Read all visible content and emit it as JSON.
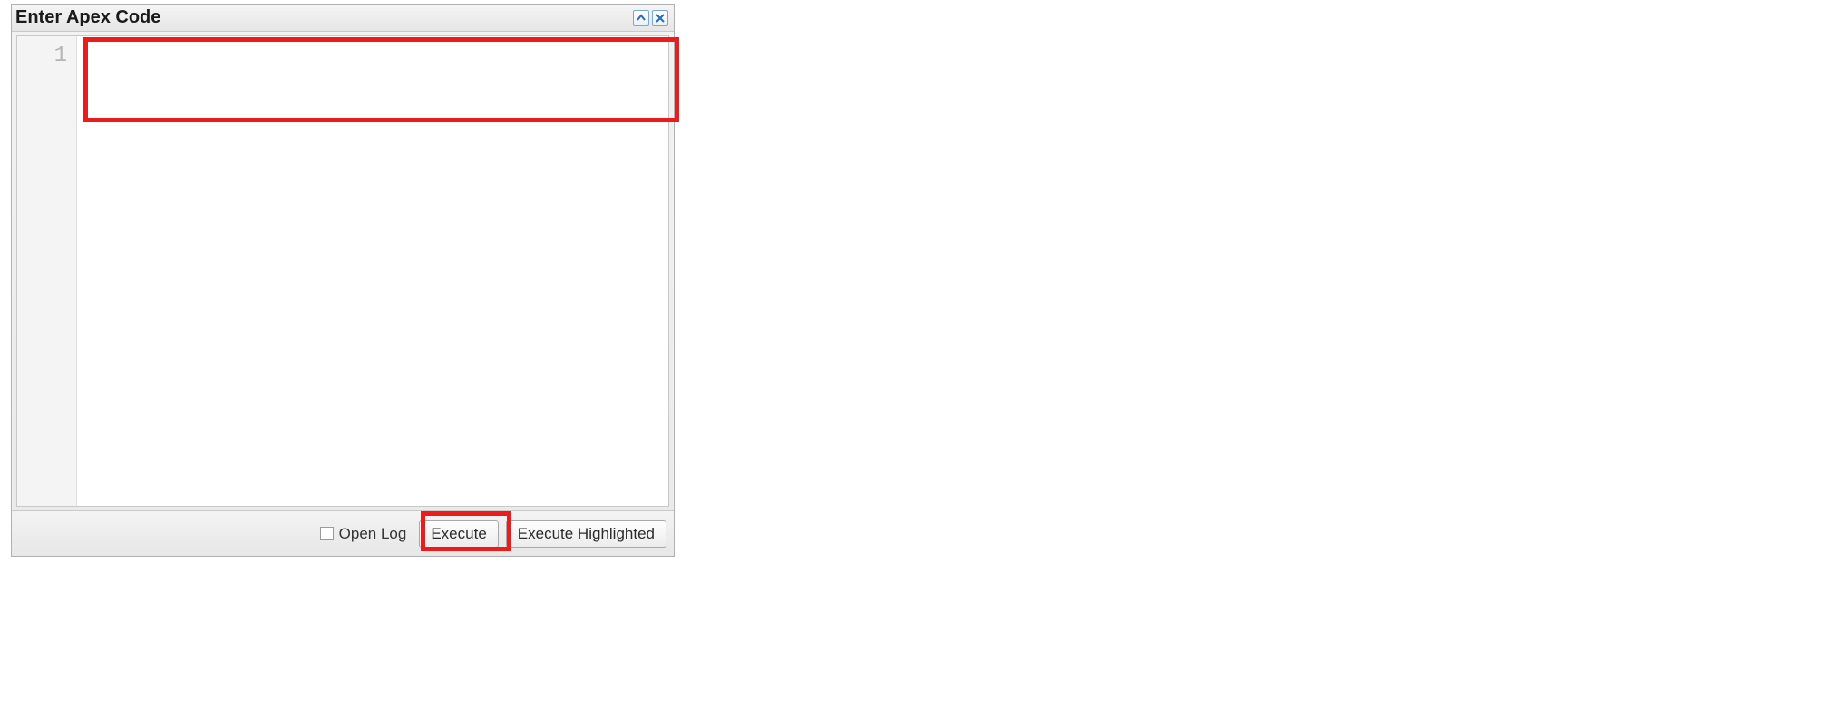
{
  "panel": {
    "title": "Enter Apex Code"
  },
  "editor": {
    "line_number": "1",
    "content": ""
  },
  "footer": {
    "open_log_label": "Open Log",
    "open_log_checked": false,
    "execute_label": "Execute",
    "execute_highlighted_label": "Execute Highlighted"
  },
  "icons": {
    "collapse": "collapse-up-icon",
    "close": "close-icon"
  },
  "colors": {
    "highlight": "#ec1c1c",
    "header_icon": "#2a6bb3",
    "panel_border": "#b0b0b0"
  }
}
